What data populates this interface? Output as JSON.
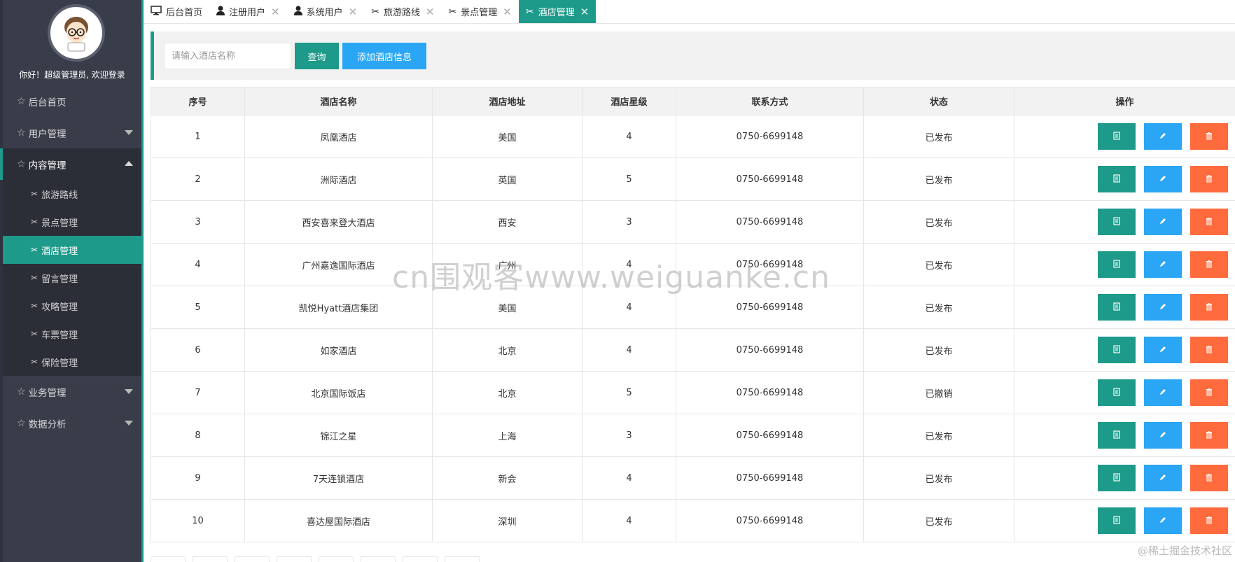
{
  "sidebar": {
    "welcome": "你好！超级管理员, 欢迎登录",
    "menu": [
      {
        "label": "后台首页"
      },
      {
        "label": "用户管理"
      },
      {
        "label": "内容管理"
      },
      {
        "label": "业务管理"
      },
      {
        "label": "数据分析"
      }
    ],
    "content_submenu": [
      {
        "label": "旅游路线"
      },
      {
        "label": "景点管理"
      },
      {
        "label": "酒店管理"
      },
      {
        "label": "留言管理"
      },
      {
        "label": "攻略管理"
      },
      {
        "label": "车票管理"
      },
      {
        "label": "保险管理"
      }
    ]
  },
  "tabs": [
    {
      "label": "后台首页",
      "icon": "monitor-icon"
    },
    {
      "label": "注册用户",
      "icon": "user-icon"
    },
    {
      "label": "系统用户",
      "icon": "user-icon"
    },
    {
      "label": "旅游路线",
      "icon": "tools-icon"
    },
    {
      "label": "景点管理",
      "icon": "tools-icon"
    },
    {
      "label": "酒店管理",
      "icon": "tools-icon"
    }
  ],
  "search": {
    "placeholder": "请输入酒店名称",
    "query_label": "查询",
    "add_label": "添加酒店信息"
  },
  "table": {
    "headers": [
      "序号",
      "酒店名称",
      "酒店地址",
      "酒店星级",
      "联系方式",
      "状态",
      "操作"
    ],
    "rows": [
      [
        "1",
        "凤凰酒店",
        "美国",
        "4",
        "0750-6699148",
        "已发布"
      ],
      [
        "2",
        "洲际酒店",
        "英国",
        "5",
        "0750-6699148",
        "已发布"
      ],
      [
        "3",
        "西安喜来登大酒店",
        "西安",
        "3",
        "0750-6699148",
        "已发布"
      ],
      [
        "4",
        "广州嘉逸国际酒店",
        "广州",
        "4",
        "0750-6699148",
        "已发布"
      ],
      [
        "5",
        "凯悦Hyatt酒店集团",
        "美国",
        "4",
        "0750-6699148",
        "已发布"
      ],
      [
        "6",
        "如家酒店",
        "北京",
        "4",
        "0750-6699148",
        "已发布"
      ],
      [
        "7",
        "北京国际饭店",
        "北京",
        "5",
        "0750-6699148",
        "已撤销"
      ],
      [
        "8",
        "锦江之星",
        "上海",
        "3",
        "0750-6699148",
        "已发布"
      ],
      [
        "9",
        "7天连锁酒店",
        "新会",
        "4",
        "0750-6699148",
        "已发布"
      ],
      [
        "10",
        "喜达屋国际酒店",
        "深圳",
        "4",
        "0750-6699148",
        "已发布"
      ]
    ]
  },
  "overlay": {
    "watermark": "cn围观客www.weiguanke.cn",
    "credit": "@稀土掘金技术社区"
  },
  "colors": {
    "sidebar_bg": "#393d49",
    "accent": "#1d9a8a",
    "blue": "#2aa6f5",
    "orange": "#ff6b3d"
  }
}
